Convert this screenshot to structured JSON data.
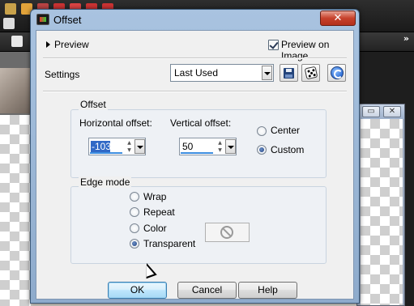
{
  "dialog": {
    "title": "Offset",
    "close_glyph": "✕"
  },
  "preview": {
    "label": "Preview",
    "preview_on_image_label": "Preview on Image",
    "preview_on_image_checked": true
  },
  "settings": {
    "label": "Settings",
    "preset_value": "Last Used",
    "icons": [
      "save-preset-icon",
      "randomize-dice-icon",
      "reset-icon"
    ]
  },
  "offset": {
    "group_title": "Offset",
    "horizontal_label": "Horizontal offset:",
    "horizontal_value": "-103",
    "vertical_label": "Vertical offset:",
    "vertical_value": "50",
    "options": [
      {
        "label": "Center",
        "selected": false
      },
      {
        "label": "Custom",
        "selected": true
      }
    ]
  },
  "edge_mode": {
    "group_title": "Edge mode",
    "options": [
      {
        "label": "Wrap",
        "selected": false
      },
      {
        "label": "Repeat",
        "selected": false
      },
      {
        "label": "Color",
        "selected": false
      },
      {
        "label": "Transparent",
        "selected": true
      }
    ],
    "color_swatch_icon": "no-color-icon"
  },
  "buttons": {
    "ok": "OK",
    "cancel": "Cancel",
    "help": "Help"
  },
  "background": {
    "more_glyph": "»",
    "right_window_buttons": [
      "▭",
      "✕"
    ]
  },
  "colors": {
    "titlebar": "#a9c3e0",
    "close_button": "#c7412c",
    "selection": "#3169c6"
  }
}
